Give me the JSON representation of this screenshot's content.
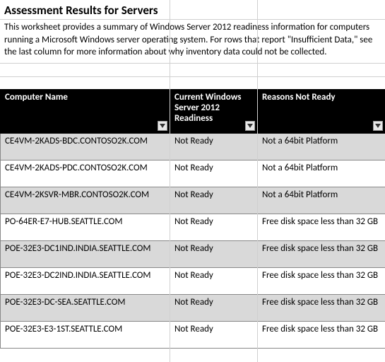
{
  "header": {
    "title": "Assessment Results for Servers",
    "description": "This worksheet provides a summary of Windows Server 2012 readiness information for computers running a Microsoft Windows server operating system. For rows that report \"Insufficient Data,\" see the last column for more information about why inventory data could not be collected."
  },
  "table": {
    "columns": [
      "Computer Name",
      "Current Windows Server 2012 Readiness",
      "Reasons Not Ready"
    ],
    "rows": [
      {
        "name": "CE4VM-2KADS-BDC.CONTOSO2K.COM",
        "readiness": "Not Ready",
        "reason": "Not a 64bit Platform"
      },
      {
        "name": "CE4VM-2KADS-PDC.CONTOSO2K.COM",
        "readiness": "Not Ready",
        "reason": "Not a 64bit Platform"
      },
      {
        "name": "CE4VM-2KSVR-MBR.CONTOSO2K.COM",
        "readiness": "Not Ready",
        "reason": "Not a 64bit Platform"
      },
      {
        "name": "PO-64ER-E7-HUB.SEATTLE.COM",
        "readiness": "Not Ready",
        "reason": "Free disk space less than 32 GB"
      },
      {
        "name": "POE-32E3-DC1IND.INDIA.SEATTLE.COM",
        "readiness": "Not Ready",
        "reason": "Free disk space less than 32 GB"
      },
      {
        "name": "POE-32E3-DC2IND.INDIA.SEATTLE.COM",
        "readiness": "Not Ready",
        "reason": "Free disk space less than 32 GB"
      },
      {
        "name": "POE-32E3-DC-SEA.SEATTLE.COM",
        "readiness": "Not Ready",
        "reason": "Free disk space less than 32 GB"
      },
      {
        "name": "POE-32E3-E3-1ST.SEATTLE.COM",
        "readiness": "Not Ready",
        "reason": "Free disk space less than 32 GB"
      }
    ]
  }
}
